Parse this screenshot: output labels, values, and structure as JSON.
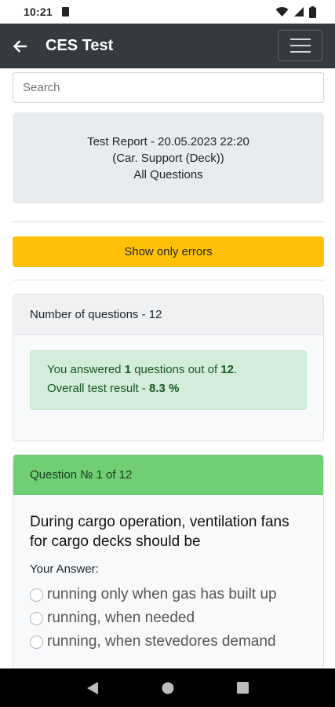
{
  "status_bar": {
    "time": "10:21",
    "icons": [
      "sim-card-icon",
      "wifi-icon",
      "signal-icon",
      "battery-icon"
    ]
  },
  "app_bar": {
    "title": "CES Test",
    "back_icon": "arrow-left-icon",
    "menu_icon": "hamburger-menu-icon",
    "background": "#343a40"
  },
  "search": {
    "placeholder": "Search",
    "value": ""
  },
  "report": {
    "line1": "Test Report - 20.05.2023 22:20",
    "line2": "(Car. Support (Deck))",
    "line3": "All Questions"
  },
  "errors_button": {
    "label": "Show only errors",
    "color": "#ffc107"
  },
  "summary": {
    "header": "Number of questions - 12",
    "answered_prefix": "You answered ",
    "answered_count": "1",
    "answered_middle": " questions out of ",
    "total_count": "12",
    "answered_suffix": ".",
    "result_prefix": "Overall test result - ",
    "result_value": "8.3 %",
    "alert_color": "#d4edda"
  },
  "question": {
    "header": "Question № 1 of 12",
    "header_color": "#6fcf72",
    "text": "During cargo operation, ventilation fans for cargo decks should be",
    "your_answer_label": "Your Answer:",
    "options": [
      "running only when gas has built up",
      "running, when needed",
      "running, when stevedores demand"
    ]
  },
  "nav_bar": {
    "icons": [
      "back-triangle-icon",
      "home-circle-icon",
      "recents-square-icon"
    ]
  }
}
